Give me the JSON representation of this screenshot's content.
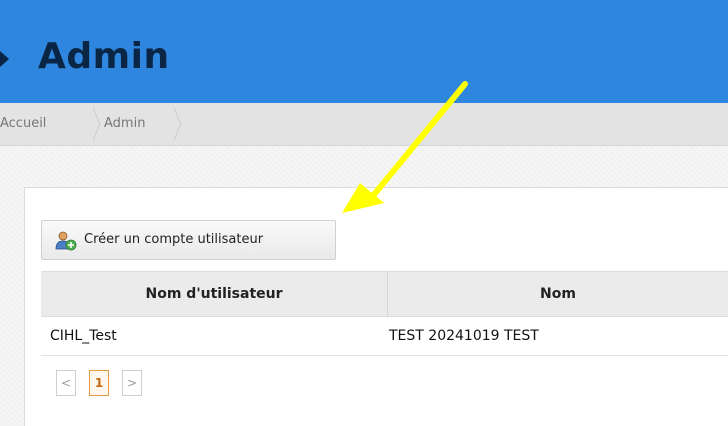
{
  "header": {
    "title": "Admin"
  },
  "breadcrumb": {
    "items": [
      "Accueil",
      "Admin"
    ]
  },
  "toolbar": {
    "create_user_label": "Créer un compte utilisateur"
  },
  "table": {
    "columns": [
      "Nom d'utilisateur",
      "Nom"
    ],
    "rows": [
      {
        "username": "CIHL_Test",
        "name": "TEST 20241019 TEST"
      }
    ]
  },
  "pagination": {
    "prev": "<",
    "current": "1",
    "next": ">"
  },
  "colors": {
    "header": "#2e86de",
    "title": "#0b2545",
    "annotation_arrow": "#ffff00"
  }
}
